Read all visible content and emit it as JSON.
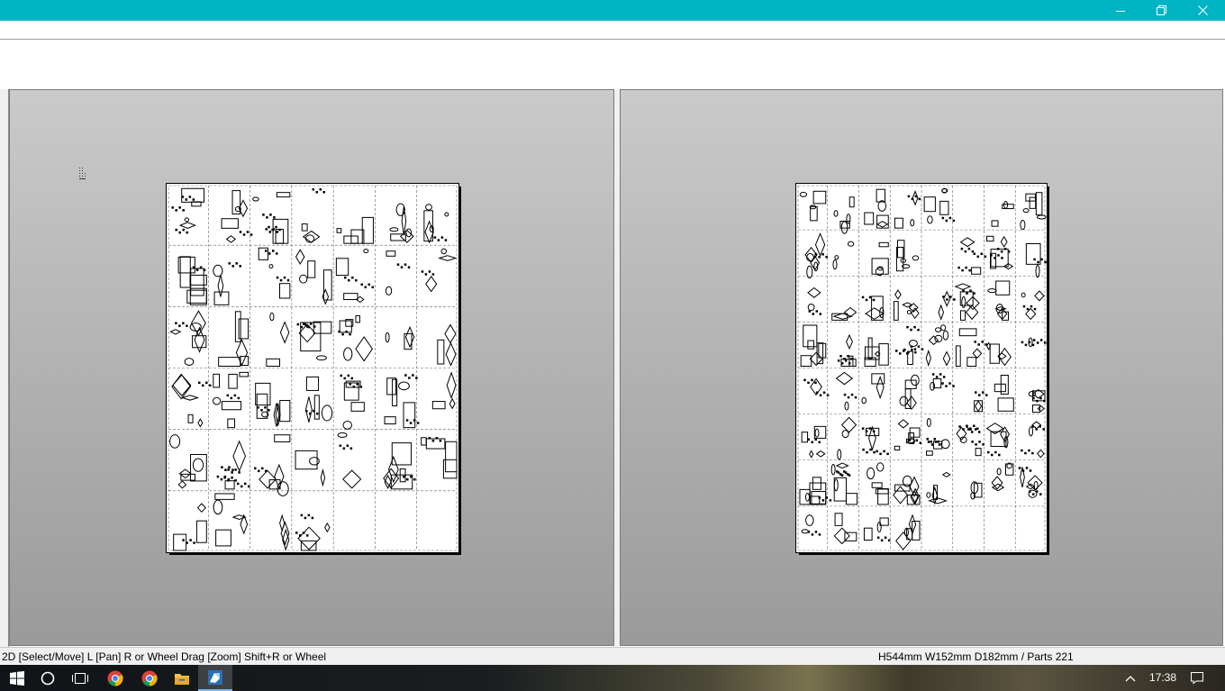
{
  "window": {
    "title": "",
    "controls": {
      "minimize": "minimize-icon",
      "restore": "restore-icon",
      "close": "close-icon"
    },
    "accent": "#00b4c4"
  },
  "statusbar": {
    "hint": "2D [Select/Move] L [Pan] R or Wheel Drag [Zoom] Shift+R or Wheel",
    "info": "H544mm W152mm D182mm / Parts 221"
  },
  "views": {
    "left": {
      "name": "pattern-sheet-view",
      "grid": {
        "cols": 7,
        "rows": 6
      }
    },
    "right": {
      "name": "pattern-sheet-view",
      "grid": {
        "cols": 8,
        "rows": 8
      }
    }
  },
  "taskbar": {
    "apps": [
      "windows-start-icon",
      "cortana-search-icon",
      "task-view-icon",
      "chrome-icon",
      "chrome-icon",
      "file-explorer-icon",
      "pepakura-icon"
    ],
    "clock": "17:38",
    "tray": [
      "show-hidden-icons-icon",
      "notification-icon"
    ]
  }
}
